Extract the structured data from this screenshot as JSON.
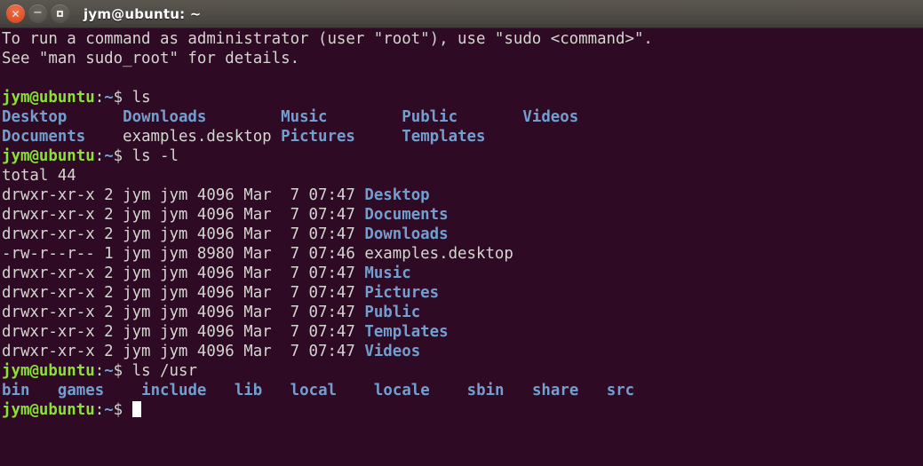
{
  "window": {
    "title": "jym@ubuntu: ~",
    "controls": [
      {
        "name": "close",
        "glyph": "×",
        "color": "#e4552c"
      },
      {
        "name": "minimize",
        "glyph": "−",
        "color": "#5c5852"
      },
      {
        "name": "maximize",
        "glyph": "□",
        "color": "#5c5852"
      }
    ]
  },
  "theme": {
    "background": "#2f0a24",
    "foreground": "#d3d7cf",
    "prompt_user_color": "#8ae234",
    "prompt_path_color": "#729fcf",
    "directory_color": "#729fcf",
    "titlebar_color": "#514d47"
  },
  "terminal": {
    "prompt": {
      "user_host": "jym@ubuntu",
      "colon": ":",
      "path": "~",
      "sigil": "$ "
    },
    "lines": [
      {
        "type": "text",
        "text": "To run a command as administrator (user \"root\"), use \"sudo <command>\"."
      },
      {
        "type": "text",
        "text": "See \"man sudo_root\" for details."
      },
      {
        "type": "blank",
        "text": ""
      },
      {
        "type": "prompt",
        "command": "ls"
      },
      {
        "type": "ls_row",
        "cells": [
          {
            "text": "Desktop",
            "kind": "dir",
            "col": 0
          },
          {
            "text": "Downloads",
            "kind": "dir",
            "col": 13
          },
          {
            "text": "Music",
            "kind": "dir",
            "col": 30
          },
          {
            "text": "Public",
            "kind": "dir",
            "col": 43
          },
          {
            "text": "Videos",
            "kind": "dir",
            "col": 56
          }
        ]
      },
      {
        "type": "ls_row",
        "cells": [
          {
            "text": "Documents",
            "kind": "dir",
            "col": 0
          },
          {
            "text": "examples.desktop",
            "kind": "file",
            "col": 13
          },
          {
            "text": "Pictures",
            "kind": "dir",
            "col": 30
          },
          {
            "text": "Templates",
            "kind": "dir",
            "col": 43
          }
        ]
      },
      {
        "type": "prompt",
        "command": "ls -l"
      },
      {
        "type": "text",
        "text": "total 44"
      },
      {
        "type": "ll_row",
        "perms": "drwxr-xr-x",
        "links": "2",
        "owner": "jym",
        "group": "jym",
        "size": "4096",
        "month": "Mar",
        "day": "7",
        "time": "07:47",
        "name": "Desktop",
        "kind": "dir"
      },
      {
        "type": "ll_row",
        "perms": "drwxr-xr-x",
        "links": "2",
        "owner": "jym",
        "group": "jym",
        "size": "4096",
        "month": "Mar",
        "day": "7",
        "time": "07:47",
        "name": "Documents",
        "kind": "dir"
      },
      {
        "type": "ll_row",
        "perms": "drwxr-xr-x",
        "links": "2",
        "owner": "jym",
        "group": "jym",
        "size": "4096",
        "month": "Mar",
        "day": "7",
        "time": "07:47",
        "name": "Downloads",
        "kind": "dir"
      },
      {
        "type": "ll_row",
        "perms": "-rw-r--r--",
        "links": "1",
        "owner": "jym",
        "group": "jym",
        "size": "8980",
        "month": "Mar",
        "day": "7",
        "time": "07:46",
        "name": "examples.desktop",
        "kind": "file"
      },
      {
        "type": "ll_row",
        "perms": "drwxr-xr-x",
        "links": "2",
        "owner": "jym",
        "group": "jym",
        "size": "4096",
        "month": "Mar",
        "day": "7",
        "time": "07:47",
        "name": "Music",
        "kind": "dir"
      },
      {
        "type": "ll_row",
        "perms": "drwxr-xr-x",
        "links": "2",
        "owner": "jym",
        "group": "jym",
        "size": "4096",
        "month": "Mar",
        "day": "7",
        "time": "07:47",
        "name": "Pictures",
        "kind": "dir"
      },
      {
        "type": "ll_row",
        "perms": "drwxr-xr-x",
        "links": "2",
        "owner": "jym",
        "group": "jym",
        "size": "4096",
        "month": "Mar",
        "day": "7",
        "time": "07:47",
        "name": "Public",
        "kind": "dir"
      },
      {
        "type": "ll_row",
        "perms": "drwxr-xr-x",
        "links": "2",
        "owner": "jym",
        "group": "jym",
        "size": "4096",
        "month": "Mar",
        "day": "7",
        "time": "07:47",
        "name": "Templates",
        "kind": "dir"
      },
      {
        "type": "ll_row",
        "perms": "drwxr-xr-x",
        "links": "2",
        "owner": "jym",
        "group": "jym",
        "size": "4096",
        "month": "Mar",
        "day": "7",
        "time": "07:47",
        "name": "Videos",
        "kind": "dir"
      },
      {
        "type": "prompt",
        "command": "ls /usr"
      },
      {
        "type": "ls_row",
        "cells": [
          {
            "text": "bin",
            "kind": "dir",
            "col": 0
          },
          {
            "text": "games",
            "kind": "dir",
            "col": 6
          },
          {
            "text": "include",
            "kind": "dir",
            "col": 15
          },
          {
            "text": "lib",
            "kind": "dir",
            "col": 25
          },
          {
            "text": "local",
            "kind": "dir",
            "col": 31
          },
          {
            "text": "locale",
            "kind": "dir",
            "col": 40
          },
          {
            "text": "sbin",
            "kind": "dir",
            "col": 50
          },
          {
            "text": "share",
            "kind": "dir",
            "col": 57
          },
          {
            "text": "src",
            "kind": "dir",
            "col": 65
          }
        ]
      },
      {
        "type": "prompt",
        "command": "",
        "cursor": true
      }
    ]
  }
}
